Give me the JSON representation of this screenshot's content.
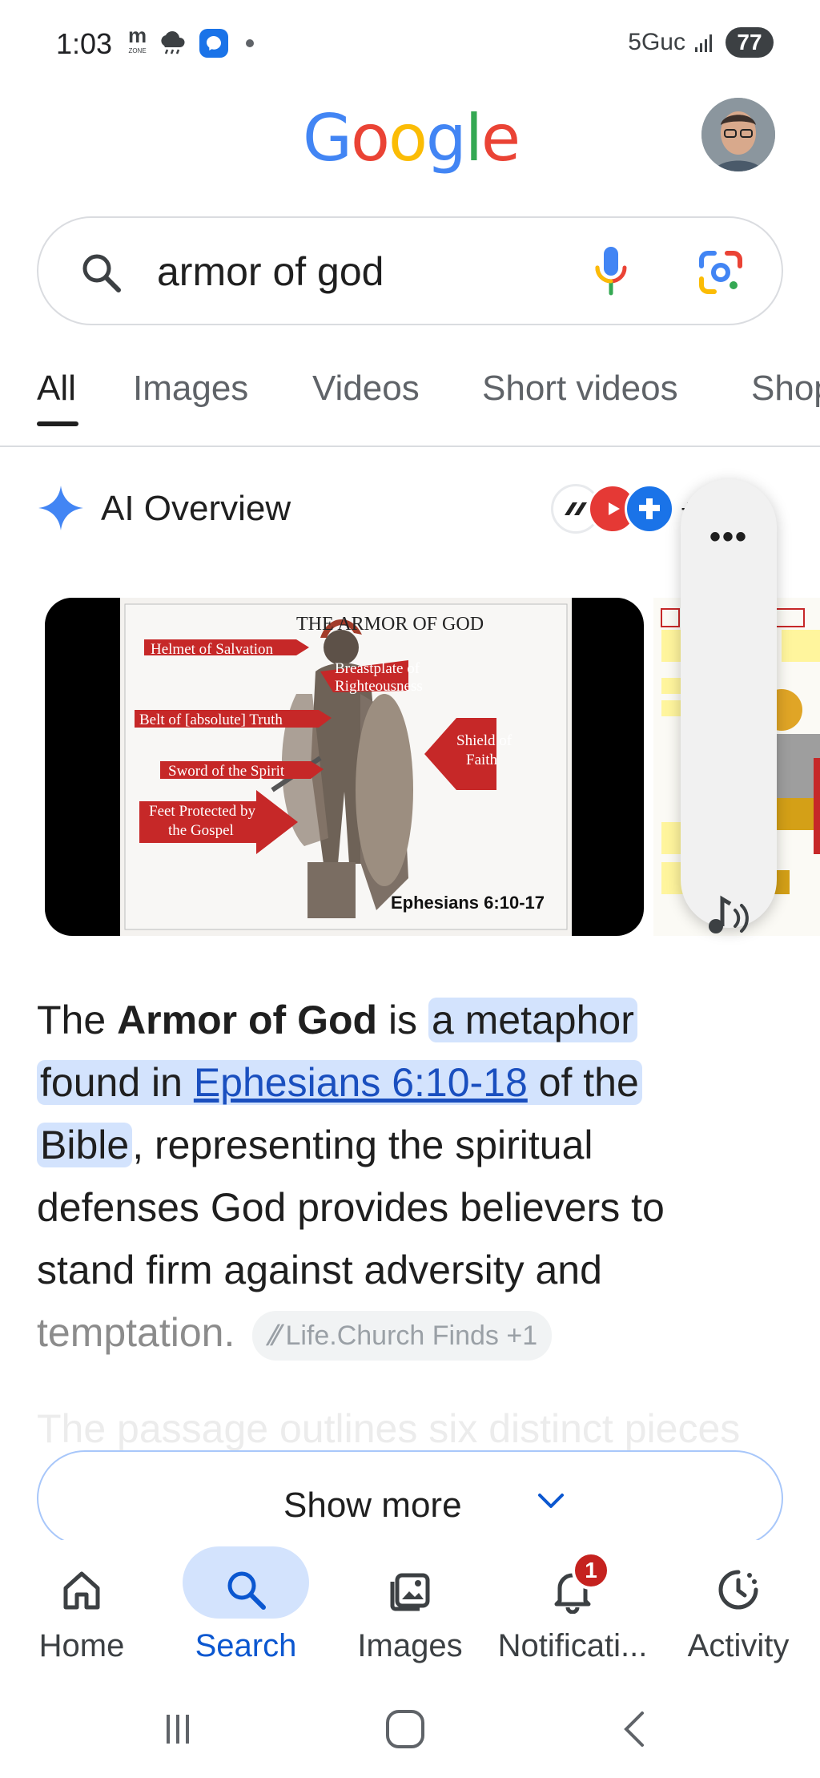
{
  "status_bar": {
    "time": "1:03",
    "network": "5Guc",
    "battery": "77"
  },
  "header": {
    "logo": [
      "G",
      "o",
      "o",
      "g",
      "l",
      "e"
    ]
  },
  "search": {
    "query": "armor of god"
  },
  "tabs": [
    {
      "label": "All"
    },
    {
      "label": "Images"
    },
    {
      "label": "Videos"
    },
    {
      "label": "Short videos"
    },
    {
      "label": "Shop"
    }
  ],
  "ai_overview": {
    "title": "AI Overview",
    "sources_more": "+",
    "image": {
      "heading": "THE ARMOR OF GOD",
      "labels": {
        "helmet": "Helmet of Salvation",
        "breastplate_1": "Breastplate of",
        "breastplate_2": "Righteousness",
        "belt": "Belt of [absolute] Truth",
        "shield_1": "Shield of",
        "shield_2": "Faith",
        "sword": "Sword of the Spirit",
        "feet_1": "Feet Protected by",
        "feet_2": "the Gospel",
        "reference": "Ephesians 6:10-17"
      }
    },
    "text": {
      "p1": "The ",
      "bold": "Armor of God",
      "p2": " is ",
      "hl1": "a metaphor",
      "hl2": "found in ",
      "link": "Ephesians 6:10-18",
      "hl3": " of the",
      "hl4": "Bible",
      "p3": ", representing the spiritual defenses God provides believers to stand firm against adversity and ",
      "faded": "temptation.",
      "citation": "Life.Church Finds +1"
    },
    "truncated_line": "The passage outlines six distinct pieces"
  },
  "show_more": {
    "label": "Show more"
  },
  "bottom_nav": [
    {
      "label": "Home"
    },
    {
      "label": "Search"
    },
    {
      "label": "Images"
    },
    {
      "label": "Notificati..."
    },
    {
      "label": "Activity"
    }
  ],
  "notification_count": "1",
  "colors": {
    "accent_blue": "#0b57d0",
    "highlight": "#d3e3fd",
    "badge_red": "#c5221f"
  }
}
